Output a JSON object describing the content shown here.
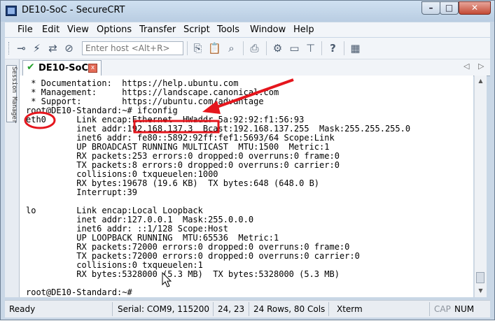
{
  "window": {
    "title": "DE10-SoC - SecureCRT",
    "controls": [
      "–",
      "□",
      "✕"
    ]
  },
  "menu": [
    "File",
    "Edit",
    "View",
    "Options",
    "Transfer",
    "Script",
    "Tools",
    "Window",
    "Help"
  ],
  "toolbar": {
    "host_placeholder": "Enter host <Alt+R>"
  },
  "side_panel": {
    "label": "Session Manager"
  },
  "tab": {
    "check": "✔",
    "label": "DE10-SoC",
    "close": "x"
  },
  "terminal": {
    "lines": [
      " * Documentation:  https://help.ubuntu.com",
      " * Management:     https://landscape.canonical.com",
      " * Support:        https://ubuntu.com/advantage",
      "root@DE10-Standard:~# ifconfig",
      "eth0      Link encap:Ethernet  HWaddr 5a:92:92:f1:56:93",
      "          inet addr:192.168.137.3  Bcast:192.168.137.255  Mask:255.255.255.0",
      "          inet6 addr: fe80::5892:92ff:fef1:5693/64 Scope:Link",
      "          UP BROADCAST RUNNING MULTICAST  MTU:1500  Metric:1",
      "          RX packets:253 errors:0 dropped:0 overruns:0 frame:0",
      "          TX packets:8 errors:0 dropped:0 overruns:0 carrier:0",
      "          collisions:0 txqueuelen:1000",
      "          RX bytes:19678 (19.6 KB)  TX bytes:648 (648.0 B)",
      "          Interrupt:39",
      "",
      "lo        Link encap:Local Loopback",
      "          inet addr:127.0.0.1  Mask:255.0.0.0",
      "          inet6 addr: ::1/128 Scope:Host",
      "          UP LOOPBACK RUNNING  MTU:65536  Metric:1",
      "          RX packets:72000 errors:0 dropped:0 overruns:0 frame:0",
      "          TX packets:72000 errors:0 dropped:0 overruns:0 carrier:0",
      "          collisions:0 txqueuelen:1",
      "          RX bytes:5328000 (5.3 MB)  TX bytes:5328000 (5.3 MB)",
      "",
      "root@DE10-Standard:~#"
    ]
  },
  "statusbar": {
    "ready": "Ready",
    "serial": "Serial: COM9, 115200",
    "cursor": "24,  23",
    "size": "24 Rows, 80 Cols",
    "emulation": "Xterm",
    "cap": "CAP",
    "num": "NUM"
  },
  "colors": {
    "annotation": "#e5161d",
    "window_frame": "#c9d7e6",
    "tab_check": "#23a12a"
  }
}
